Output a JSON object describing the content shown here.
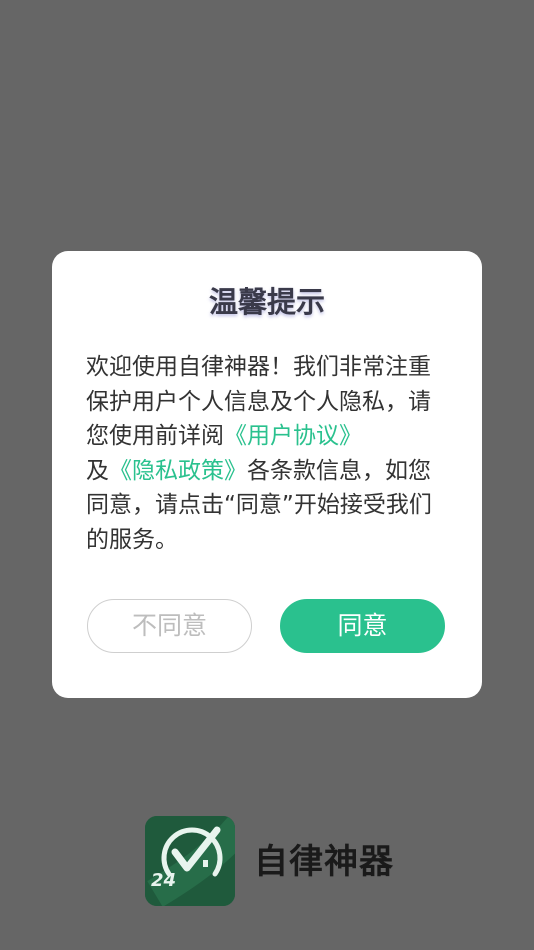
{
  "dialog": {
    "title": "温馨提示",
    "body_text_1": "欢迎使用自律神器！我们非常注重保护用户个人信息及个人隐私，请您使用前详阅",
    "user_agreement_link": "《用户协议》",
    "body_text_2": "及",
    "privacy_policy_link": "《隐私政策》",
    "body_text_3": "各条款信息，如您同意，请点击“同意”开始接受我们的服务。",
    "disagree_label": "不同意",
    "agree_label": "同意"
  },
  "app": {
    "name": "自律神器",
    "logo_text": "24",
    "logo_icon": "clock-checkmark-logo"
  },
  "colors": {
    "accent": "#2ac18e",
    "overlay": "#666666",
    "logo_bg": "#1f5a3c"
  }
}
